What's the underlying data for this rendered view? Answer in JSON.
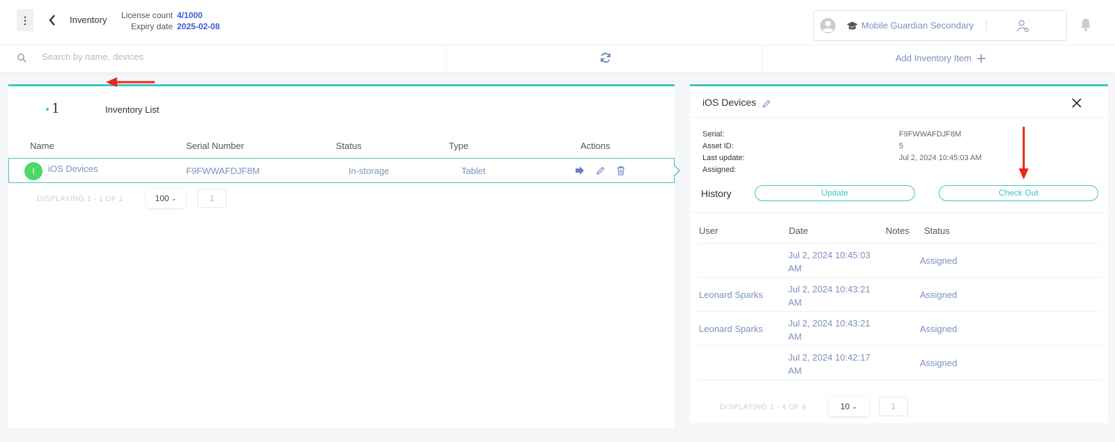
{
  "header": {
    "menu_icon": "kebab-icon",
    "back_icon": "chevron-left-icon",
    "breadcrumb": "Inventory",
    "license_label": "License count",
    "license_value": "4/1000",
    "expiry_label": "Expiry date",
    "expiry_value": "2025-02-08",
    "school_name": "Mobile Guardian Secondary",
    "accent_color": "#3c59d6"
  },
  "toolbar": {
    "search_placeholder": "Search by name, devices",
    "add_label": "Add Inventory Item"
  },
  "inventory_list": {
    "count": "1",
    "title": "Inventory List",
    "columns": [
      "Name",
      "Serial Number",
      "Status",
      "Type",
      "Actions"
    ],
    "rows": [
      {
        "initial": "I",
        "name": "iOS Devices",
        "serial": "F9FWWAFDJF8M",
        "status": "In-storage",
        "type": "Tablet"
      }
    ],
    "displaying": "DISPLAYING 1 - 1 OF 1",
    "page_size": "100",
    "page": "1"
  },
  "detail": {
    "title": "iOS Devices",
    "fields": [
      {
        "label": "Serial:",
        "value": "F9FWWAFDJF8M"
      },
      {
        "label": "Asset ID:",
        "value": "5"
      },
      {
        "label": "Last update:",
        "value": "Jul 2, 2024 10:45:03 AM"
      },
      {
        "label": "Assigned:",
        "value": ""
      }
    ],
    "history_label": "History",
    "update_button": "Update",
    "checkout_button": "Check Out",
    "history_columns": [
      "User",
      "Date",
      "Notes",
      "Status"
    ],
    "history_rows": [
      {
        "user": "",
        "date": "Jul 2, 2024 10:45:03 AM",
        "notes": "",
        "status": "Assigned"
      },
      {
        "user": "Leonard Sparks",
        "date": "Jul 2, 2024 10:43:21 AM",
        "notes": "",
        "status": "Assigned"
      },
      {
        "user": "Leonard Sparks",
        "date": "Jul 2, 2024 10:43:21 AM",
        "notes": "",
        "status": "Assigned"
      },
      {
        "user": "",
        "date": "Jul 2, 2024 10:42:17 AM",
        "notes": "",
        "status": "Assigned"
      }
    ],
    "displaying": "DISPLAYING 1 - 4 OF 4",
    "page_size": "10",
    "page": "1"
  },
  "colors": {
    "teal": "#3ec6c0",
    "link": "#7c8fc1",
    "arrow": "#e8271c",
    "avatar": "#4dd66a"
  }
}
